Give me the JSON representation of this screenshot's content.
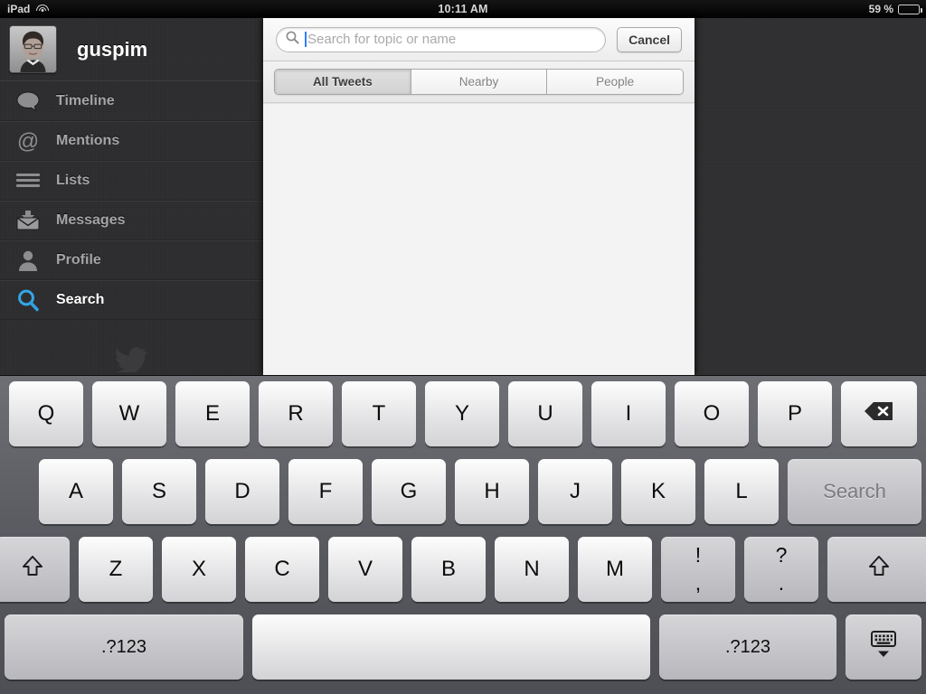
{
  "status_bar": {
    "device_label": "iPad",
    "wifi_icon": "wifi-icon",
    "time": "10:11 AM",
    "battery_percent": "59 %",
    "battery_level": 59,
    "battery_icon": "battery-icon"
  },
  "sidebar": {
    "account": {
      "username": "guspim",
      "avatar_icon": "user-avatar-photo"
    },
    "items": [
      {
        "label": "Timeline",
        "icon": "speech-bubble-icon",
        "active": false
      },
      {
        "label": "Mentions",
        "icon": "at-sign-icon",
        "active": false
      },
      {
        "label": "Lists",
        "icon": "list-lines-icon",
        "active": false
      },
      {
        "label": "Messages",
        "icon": "envelope-icon",
        "active": false
      },
      {
        "label": "Profile",
        "icon": "person-icon",
        "active": false
      },
      {
        "label": "Search",
        "icon": "magnifier-icon",
        "active": true
      }
    ],
    "logo_icon": "twitter-bird-icon"
  },
  "search_panel": {
    "search_input": {
      "value": "",
      "placeholder": "Search for topic or name",
      "icon": "search-icon"
    },
    "cancel_label": "Cancel",
    "segments": [
      {
        "label": "All Tweets",
        "selected": true
      },
      {
        "label": "Nearby",
        "selected": false
      },
      {
        "label": "People",
        "selected": false
      }
    ]
  },
  "keyboard": {
    "row1": [
      "Q",
      "W",
      "E",
      "R",
      "T",
      "Y",
      "U",
      "I",
      "O",
      "P"
    ],
    "backspace_icon": "backspace-icon",
    "row2": [
      "A",
      "S",
      "D",
      "F",
      "G",
      "H",
      "J",
      "K",
      "L"
    ],
    "return_label": "Search",
    "row3": [
      "Z",
      "X",
      "C",
      "V",
      "B",
      "N",
      "M"
    ],
    "shift_left_icon": "shift-arrow-icon",
    "shift_right_icon": "shift-arrow-icon",
    "punct1": {
      "top": "!",
      "bottom": ","
    },
    "punct2": {
      "top": "?",
      "bottom": "."
    },
    "numeric_left_label": ".?123",
    "numeric_right_label": ".?123",
    "space_label": "",
    "hide_keyboard_icon": "hide-keyboard-icon"
  },
  "colors": {
    "accent_blue": "#2d7ff9",
    "sidebar_bg": "#2e2e30",
    "panel_bg": "#f3f3f3",
    "keyboard_bg": "#57595f"
  }
}
